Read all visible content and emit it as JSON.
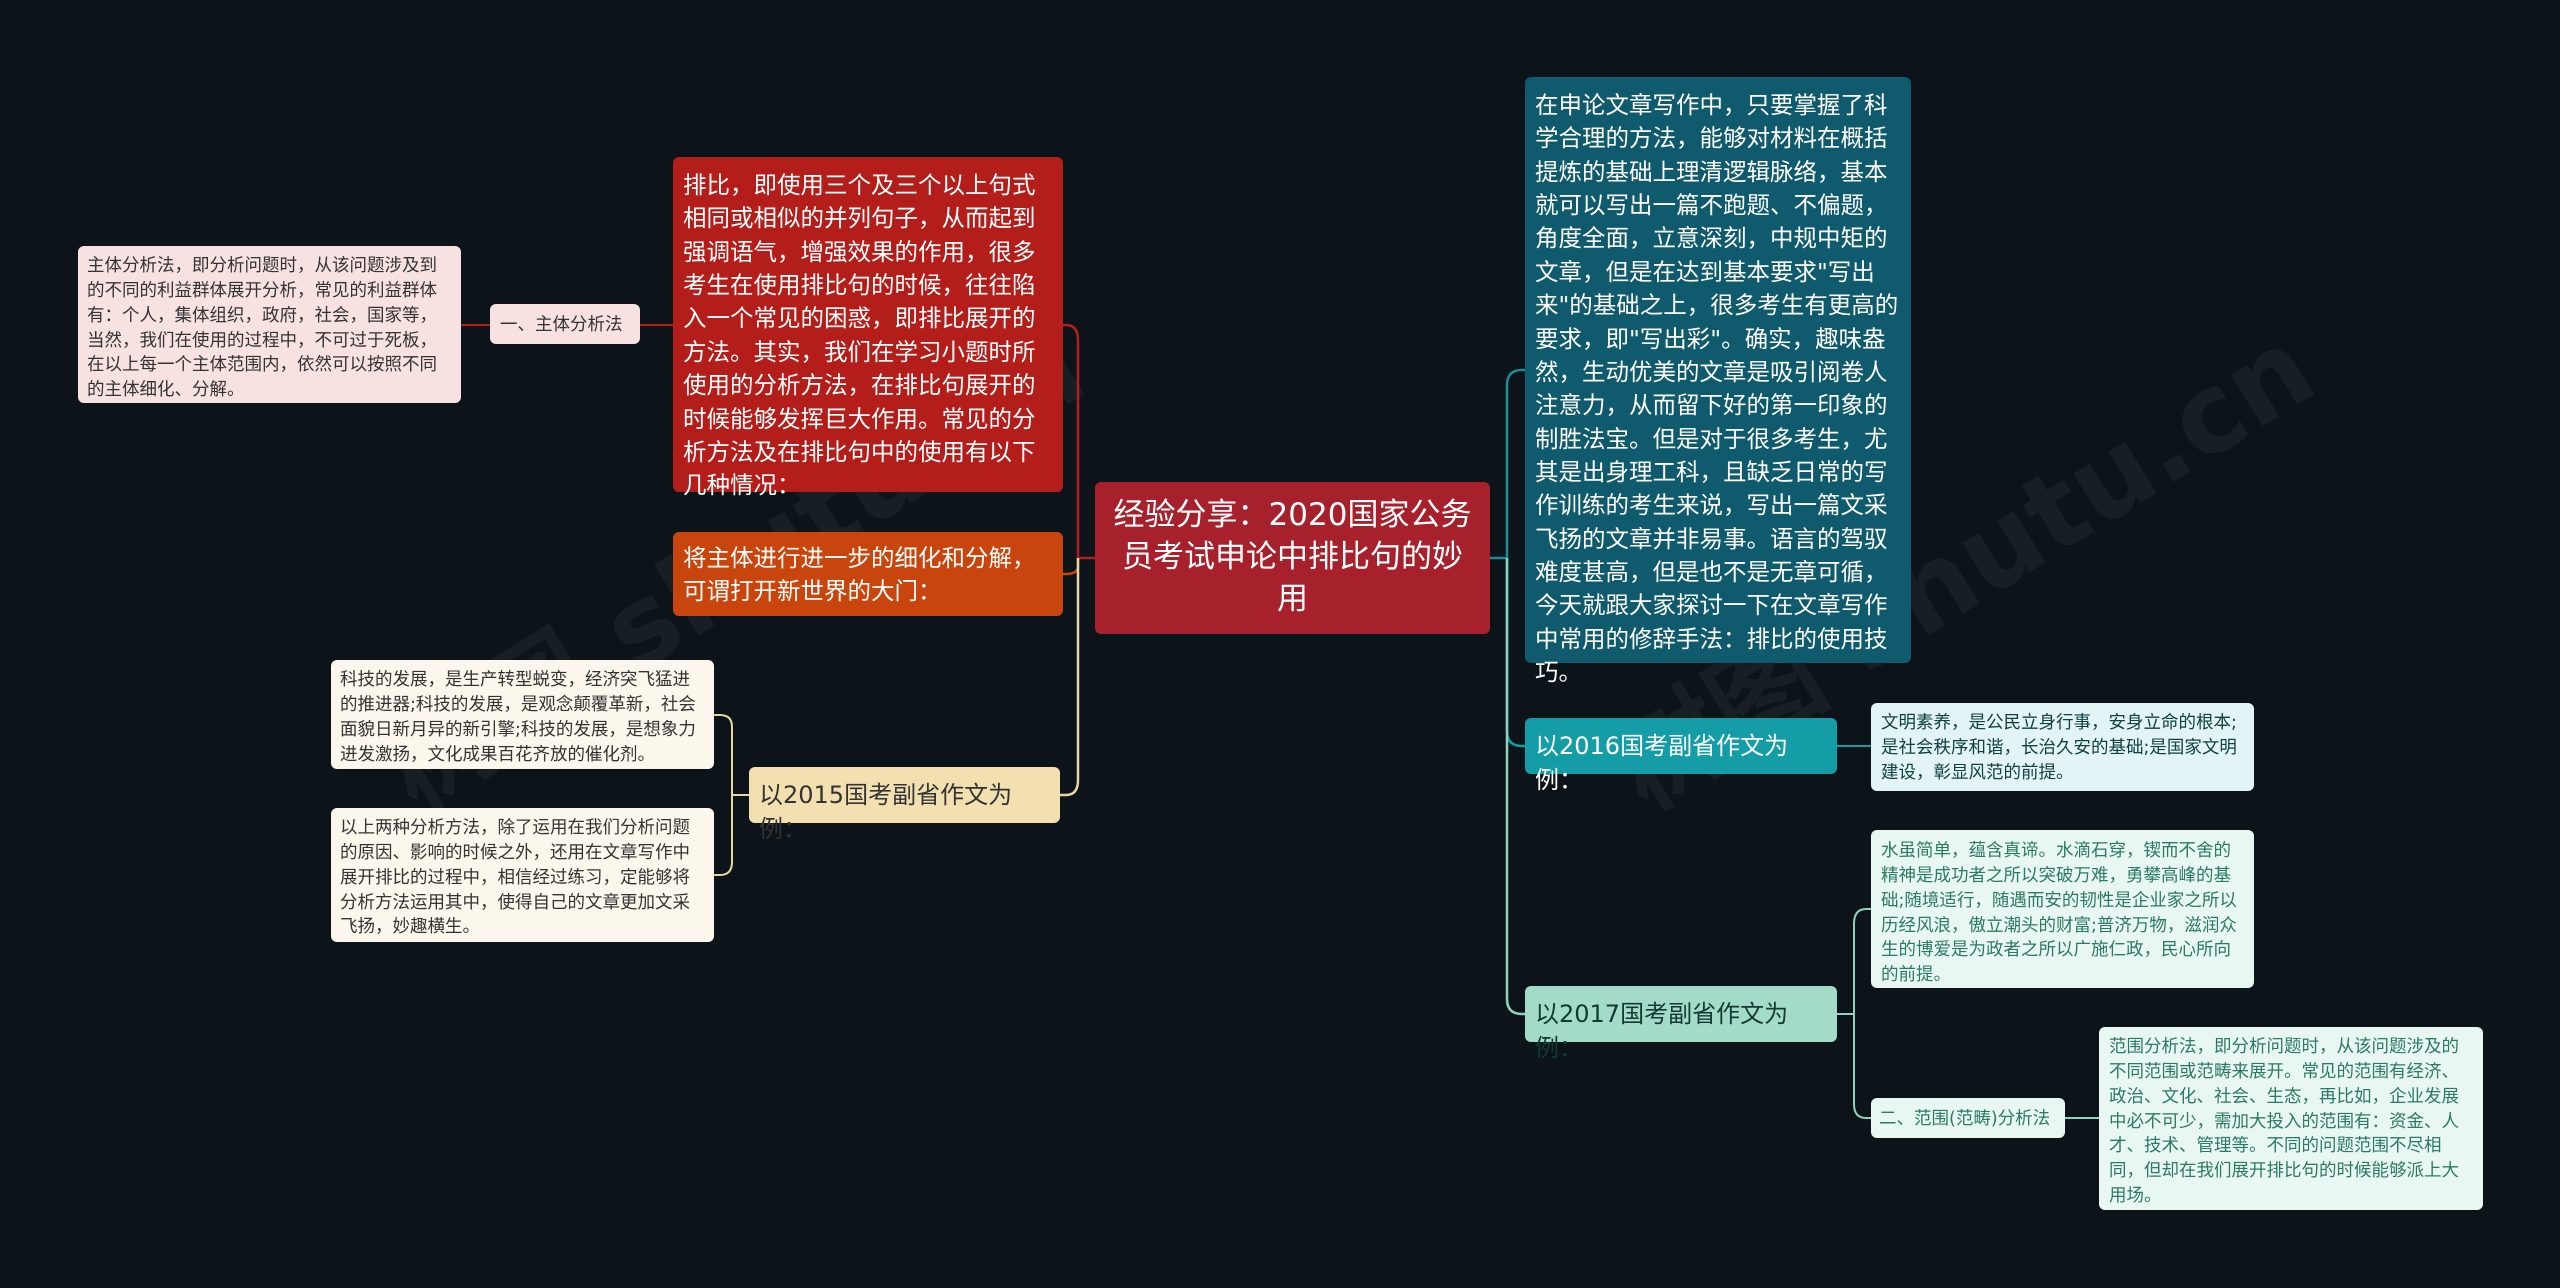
{
  "mindmap": {
    "root": "经验分享：2020国家公务员考试申论中排比句的妙用",
    "right": {
      "intro": "在申论文章写作中，只要掌握了科学合理的方法，能够对材料在概括提炼的基础上理清逻辑脉络，基本就可以写出一篇不跑题、不偏题，角度全面，立意深刻，中规中矩的文章，但是在达到基本要求\"写出来\"的基础之上，很多考生有更高的要求，即\"写出彩\"。确实，趣味盎然，生动优美的文章是吸引阅卷人注意力，从而留下好的第一印象的制胜法宝。但是对于很多考生，尤其是出身理工科，且缺乏日常的写作训练的考生来说，写出一篇文采飞扬的文章并非易事。语言的驾驭难度甚高，但是也不是无章可循，今天就跟大家探讨一下在文章写作中常用的修辞手法：排比的使用技巧。",
      "y2016": {
        "label": "以2016国考副省作文为例：",
        "leaf": "文明素养，是公民立身行事，安身立命的根本;是社会秩序和谐，长治久安的基础;是国家文明建设，彰显风范的前提。"
      },
      "y2017": {
        "label": "以2017国考副省作文为例：",
        "leaf": "水虽简单，蕴含真谛。水滴石穿，锲而不舍的精神是成功者之所以突破万难，勇攀高峰的基础;随境适行，随遇而安的韧性是企业家之所以历经风浪，傲立潮头的财富;普济万物，滋润众生的博爱是为政者之所以广施仁政，民心所向的前提。",
        "scope": {
          "label": "二、范围(范畴)分析法",
          "leaf": "范围分析法，即分析问题时，从该问题涉及的不同范围或范畴来展开。常见的范围有经济、政治、文化、社会、生态，再比如，企业发展中必不可少，需加大投入的范围有：资金、人才、技术、管理等。不同的问题范围不尽相同，但却在我们展开排比句的时候能够派上大用场。"
        }
      }
    },
    "left": {
      "paibi": "排比，即使用三个及三个以上句式相同或相似的并列句子，从而起到强调语气，增强效果的作用，很多考生在使用排比句的时候，往往陷入一个常见的困惑，即排比展开的方法。其实，我们在学习小题时所使用的分析方法，在排比句展开的时候能够发挥巨大作用。常见的分析方法及在排比句中的使用有以下几种情况：",
      "subject": {
        "label": "一、主体分析法",
        "leaf": "主体分析法，即分析问题时，从该问题涉及到的不同的利益群体展开分析，常见的利益群体有：个人，集体组织，政府，社会，国家等，当然，我们在使用的过程中，不可过于死板，在以上每一个主体范围内，依然可以按照不同的主体细化、分解。"
      },
      "refine": "将主体进行进一步的细化和分解，可谓打开新世界的大门：",
      "y2015": {
        "label": "以2015国考副省作文为例：",
        "tech": "科技的发展，是生产转型蜕变，经济突飞猛进的推进器;科技的发展，是观念颠覆革新，社会面貌日新月异的新引擎;科技的发展，是想象力进发激扬，文化成果百花齐放的催化剂。",
        "summary": "以上两种分析方法，除了运用在我们分析问题的原因、影响的时候之外，还用在文章写作中展开排比的过程中，相信经过练习，定能够将分析方法运用其中，使得自己的文章更加文采飞扬，妙趣横生。"
      }
    }
  },
  "watermark": [
    "树图 shutu.cn",
    "树图 shutu.cn"
  ],
  "colors": {
    "background": "#0c1419",
    "root": "#a6212c",
    "teal_dark": "#0f5a6c",
    "teal": "#149da7",
    "mint": "#a3dbc8",
    "red": "#b41e1a",
    "orange": "#c8460e",
    "sand": "#f3e0b0",
    "link_red": "#b41e1a",
    "link_teal": "#1e8a95",
    "link_mint": "#8fd2bb",
    "link_sand": "#e8d6a4"
  }
}
